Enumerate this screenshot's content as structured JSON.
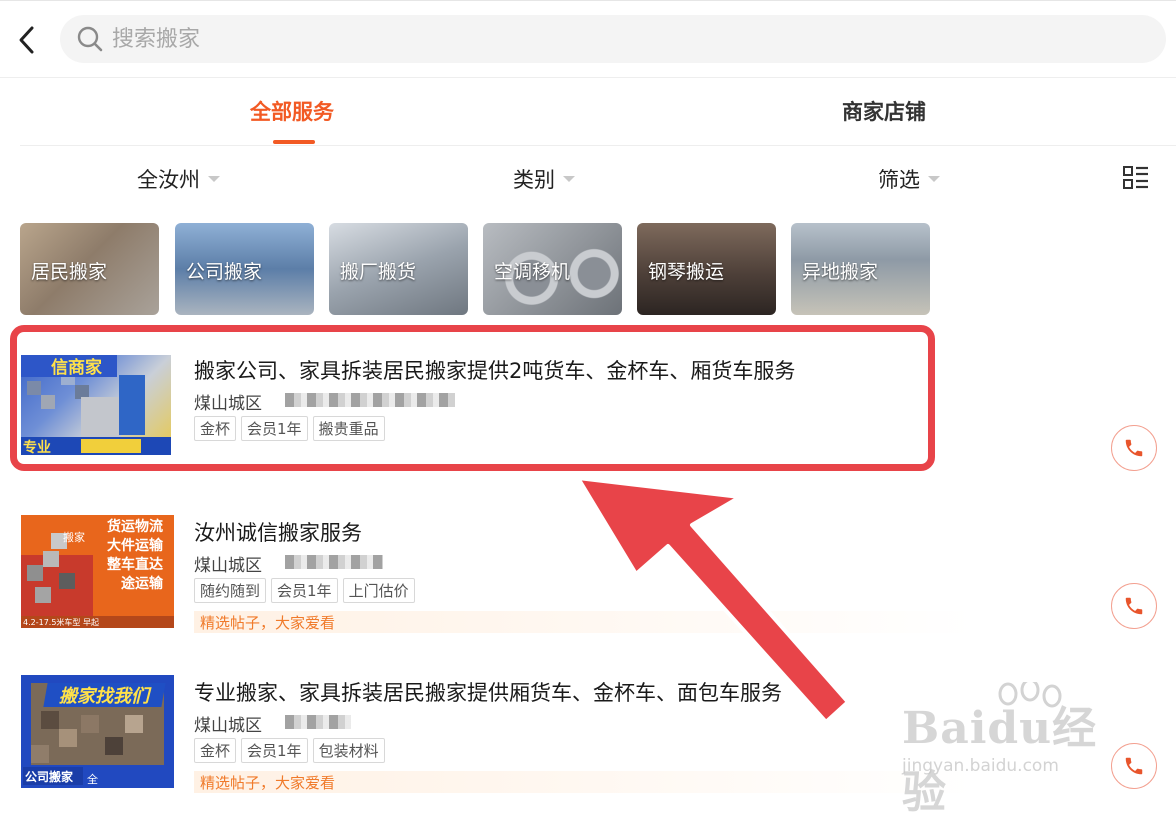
{
  "header": {
    "search_placeholder": "搜索搬家",
    "icons": [
      "back-arrow-icon",
      "search-icon"
    ]
  },
  "tabs": [
    {
      "label": "全部服务",
      "active": true
    },
    {
      "label": "商家店铺",
      "active": false
    }
  ],
  "filters": [
    {
      "label": "全汝州"
    },
    {
      "label": "类别"
    },
    {
      "label": "筛选"
    }
  ],
  "view_toggle_icon": "list-grid-icon",
  "categories": [
    {
      "label": "居民搬家"
    },
    {
      "label": "公司搬家"
    },
    {
      "label": "搬厂搬货"
    },
    {
      "label": "空调移机"
    },
    {
      "label": "钢琴搬运"
    },
    {
      "label": "异地搬家"
    }
  ],
  "listings": [
    {
      "title": "搬家公司、家具拆装居民搬家提供2吨货车、金杯车、厢货车服务",
      "location": "煤山城区",
      "tags": [
        "金杯",
        "会员1年",
        "搬贵重品"
      ],
      "thumb_text": [
        "信商家",
        "专业"
      ],
      "highlighted": true
    },
    {
      "title": "汝州诚信搬家服务",
      "location": "煤山城区",
      "tags": [
        "随约随到",
        "会员1年",
        "上门估价"
      ],
      "promo": "精选帖子，大家爱看",
      "thumb_text": [
        "货运物流",
        "大件运输",
        "整车直达",
        "途运输",
        "搬家",
        "4.2-17.5米车型 早起"
      ]
    },
    {
      "title": "专业搬家、家具拆装居民搬家提供厢货车、金杯车、面包车服务",
      "location": "煤山城区",
      "tags": [
        "金杯",
        "会员1年",
        "包装材料"
      ],
      "promo": "精选帖子，大家爱看",
      "thumb_text": [
        "搬家找我们",
        "公司搬家",
        "全"
      ]
    }
  ],
  "watermark": {
    "main": "Baidu经验",
    "sub": "jingyan.baidu.com"
  },
  "colors": {
    "accent": "#f25a24",
    "highlight_box": "#e84449",
    "promo_text": "#f07a2a"
  }
}
